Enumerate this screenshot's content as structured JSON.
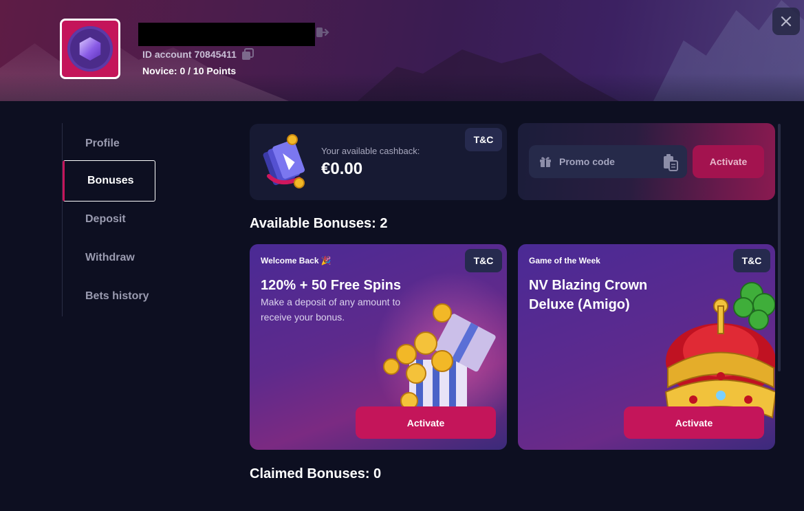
{
  "header": {
    "account_id": "ID account 70845411",
    "level": "Novice: 0  / 10 Points"
  },
  "sidebar": {
    "items": [
      {
        "label": "Profile",
        "active": false
      },
      {
        "label": "Bonuses",
        "active": true
      },
      {
        "label": "Deposit",
        "active": false
      },
      {
        "label": "Withdraw",
        "active": false
      },
      {
        "label": "Bets history",
        "active": false
      }
    ]
  },
  "cashback": {
    "label": "Your available cashback:",
    "amount": "€0.00",
    "tc": "T&C"
  },
  "promo": {
    "placeholder": "Promo code",
    "button": "Activate"
  },
  "available_title": "Available Bonuses: 2",
  "bonuses": [
    {
      "tag": "Welcome Back 🎉",
      "title": "120% + 50 Free Spins",
      "description": "Make a deposit of any amount to receive your bonus.",
      "tc": "T&C",
      "button": "Activate"
    },
    {
      "tag": "Game of the Week",
      "title": "NV Blazing Crown Deluxe (Amigo)",
      "description": "",
      "tc": "T&C",
      "button": "Activate"
    }
  ],
  "claimed_title": "Claimed Bonuses: 0",
  "colors": {
    "accent": "#c4155a",
    "background": "#0d0f21",
    "card": "#171a33"
  }
}
